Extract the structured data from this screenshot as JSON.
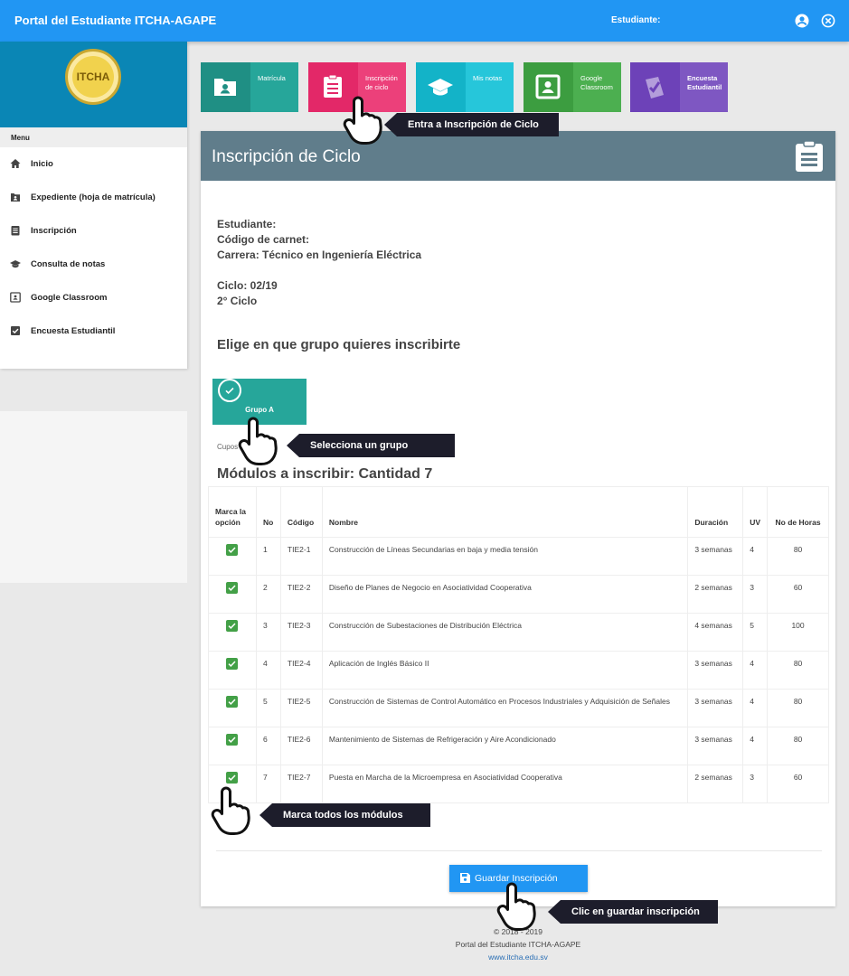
{
  "topbar": {
    "title": "Portal del Estudiante ITCHA-AGAPE",
    "student_label": "Estudiante:"
  },
  "sidebar": {
    "logo_text": "ITCHA",
    "menu_heading": "Menu",
    "items": [
      {
        "label": "Inicio",
        "icon": "home-icon"
      },
      {
        "label": "Expediente (hoja de matrícula)",
        "icon": "folder-icon"
      },
      {
        "label": "Inscripción",
        "icon": "clipboard-icon"
      },
      {
        "label": "Consulta de notas",
        "icon": "graduation-cap-icon"
      },
      {
        "label": "Google Classroom",
        "icon": "classroom-icon"
      },
      {
        "label": "Encuesta Estudiantil",
        "icon": "checkbox-icon"
      }
    ]
  },
  "tiles": [
    {
      "label": "Matrícula",
      "icon": "folder-person-icon",
      "color": "#26a69a",
      "dark": "#1c8a7f"
    },
    {
      "label": "Inscripción de ciclo",
      "icon": "clipboard-icon",
      "color": "#ec407a",
      "dark": "#d81b60"
    },
    {
      "label": "Mis notas",
      "icon": "graduation-cap-icon",
      "color": "#26c6da",
      "dark": "#00acc1"
    },
    {
      "label": "Google Classroom",
      "icon": "classroom-icon",
      "color": "#4caf50",
      "dark": "#388e3c"
    },
    {
      "label": "Encuesta Estudiantil",
      "icon": "survey-check-icon",
      "color": "#7e57c2",
      "dark": "#673ab7"
    }
  ],
  "card": {
    "title": "Inscripción de Ciclo",
    "student": "Estudiante:",
    "carnet": "Código de carnet:",
    "career": "Carrera: Técnico en Ingeniería Eléctrica",
    "cycle": "Ciclo: 02/19",
    "cycle_num": "2° Ciclo",
    "choose_group": "Elige en que grupo quieres inscribirte",
    "group_name": "Grupo A",
    "cupos": "Cupos",
    "modules_heading": "Módulos a inscribir: Cantidad 7"
  },
  "table": {
    "headers": [
      "Marca la opción",
      "No",
      "Código",
      "Nombre",
      "Duración",
      "UV",
      "No de Horas"
    ],
    "rows": [
      {
        "no": "1",
        "code": "TIE2-1",
        "name": "Construcción de Líneas Secundarias en baja y media tensión",
        "duration": "3 semanas",
        "uv": "4",
        "hours": "80",
        "checked": true
      },
      {
        "no": "2",
        "code": "TIE2-2",
        "name": "Diseño de Planes de Negocio en Asociatividad Cooperativa",
        "duration": "2 semanas",
        "uv": "3",
        "hours": "60",
        "checked": true
      },
      {
        "no": "3",
        "code": "TIE2-3",
        "name": "Construcción de Subestaciones de Distribución Eléctrica",
        "duration": "4 semanas",
        "uv": "5",
        "hours": "100",
        "checked": true
      },
      {
        "no": "4",
        "code": "TIE2-4",
        "name": "Aplicación de Inglés Básico II",
        "duration": "3 semanas",
        "uv": "4",
        "hours": "80",
        "checked": true
      },
      {
        "no": "5",
        "code": "TIE2-5",
        "name": "Construcción de Sistemas de Control Automático en Procesos Industriales y Adquisición de Señales",
        "duration": "3 semanas",
        "uv": "4",
        "hours": "80",
        "checked": true
      },
      {
        "no": "6",
        "code": "TIE2-6",
        "name": "Mantenimiento de Sistemas de Refrigeración y Aire Acondicionado",
        "duration": "3 semanas",
        "uv": "4",
        "hours": "80",
        "checked": true
      },
      {
        "no": "7",
        "code": "TIE2-7",
        "name": "Puesta en Marcha de la Microempresa en Asociatividad Cooperativa",
        "duration": "2 semanas",
        "uv": "3",
        "hours": "60",
        "checked": true
      }
    ]
  },
  "save_label": "Guardar Inscripción",
  "footer": {
    "copyright": "© 2018 - 2019",
    "org": "Portal del Estudiante ITCHA-AGAPE",
    "link": "www.itcha.edu.sv"
  },
  "callouts": {
    "tile": "Entra a Inscripción de Ciclo",
    "group": "Selecciona un grupo",
    "modules": "Marca todos los módulos",
    "save": "Clic en guardar inscripción"
  },
  "colors": {
    "primary": "#2196f3",
    "header_gray": "#607d8b",
    "teal": "#26a69a",
    "check_green": "#43a047"
  }
}
